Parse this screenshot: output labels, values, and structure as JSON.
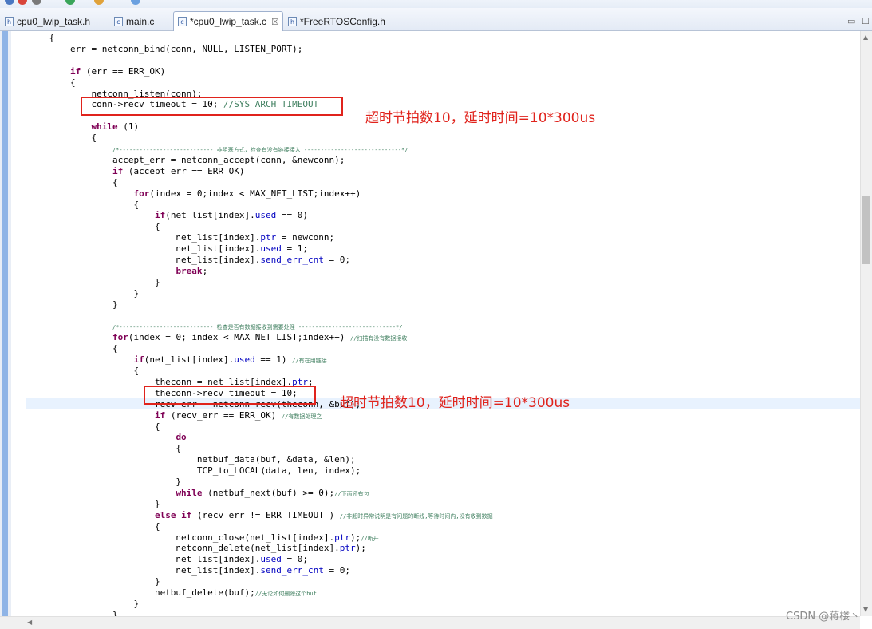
{
  "tabs": [
    {
      "label": "cpu0_lwip_task.h",
      "icon": "h-file-icon",
      "active": false
    },
    {
      "label": "main.c",
      "icon": "c-file-icon",
      "active": false
    },
    {
      "label": "*cpu0_lwip_task.c",
      "icon": "c-file-icon",
      "active": true,
      "close": "☒"
    },
    {
      "label": "*FreeRTOSConfig.h",
      "icon": "h-file-icon",
      "active": false
    }
  ],
  "window_controls": {
    "minimize": "▭",
    "maximize": "☐"
  },
  "code_lines": [
    "    {",
    "        err = netconn_bind(conn, NULL, LISTEN_PORT);",
    "",
    "        if (err == ERR_OK)",
    "        {",
    "            netconn_listen(conn);",
    "            conn->recv_timeout = 10; //SYS_ARCH_TIMEOUT",
    "",
    "            while (1)",
    "            {",
    "                /*---------------------------- 非阻塞方式，检查有没有链接接入 -----------------------------*/",
    "                accept_err = netconn_accept(conn, &newconn);",
    "                if (accept_err == ERR_OK)",
    "                {",
    "                    for(index = 0;index < MAX_NET_LIST;index++)",
    "                    {",
    "                        if(net_list[index].used == 0)",
    "                        {",
    "                            net_list[index].ptr = newconn;",
    "                            net_list[index].used = 1;",
    "                            net_list[index].send_err_cnt = 0;",
    "                            break;",
    "                        }",
    "                    }",
    "                }",
    "",
    "                /*---------------------------- 检查是否有数据接收到需要处理 -----------------------------*/",
    "                for(index = 0; index < MAX_NET_LIST;index++) //扫描有没有数据接收",
    "                {",
    "                    if(net_list[index].used == 1) //有在用链接",
    "                    {",
    "                        theconn = net_list[index].ptr;",
    "                        theconn->recv_timeout = 10;",
    "                        recv_err = netconn_recv(theconn, &buf);",
    "                        if (recv_err == ERR_OK) //有数据处理之",
    "                        {",
    "                            do",
    "                            {",
    "                                netbuf_data(buf, &data, &len);",
    "                                TCP_to_LOCAL(data, len, index);",
    "                            }",
    "                            while (netbuf_next(buf) >= 0);//下面还有包",
    "                        }",
    "                        else if (recv_err != ERR_TIMEOUT ) //非超时异常说明是有问题的断线,等待时间内,没有收到数据",
    "                        {",
    "                            netconn_close(net_list[index].ptr);//断开",
    "                            netconn_delete(net_list[index].ptr);",
    "                            net_list[index].used = 0;",
    "                            net_list[index].send_err_cnt = 0;",
    "                        }",
    "                        netbuf_delete(buf);//无论如何删除这个buf",
    "                    }",
    "                }"
  ],
  "annotations": [
    {
      "text": "超时节拍数10，延时时间=10*300us",
      "color": "#e0231c"
    },
    {
      "text": "超时节拍数10，延时时间=10*300us",
      "color": "#e0231c"
    }
  ],
  "watermark": "CSDN @蒋楼丶"
}
